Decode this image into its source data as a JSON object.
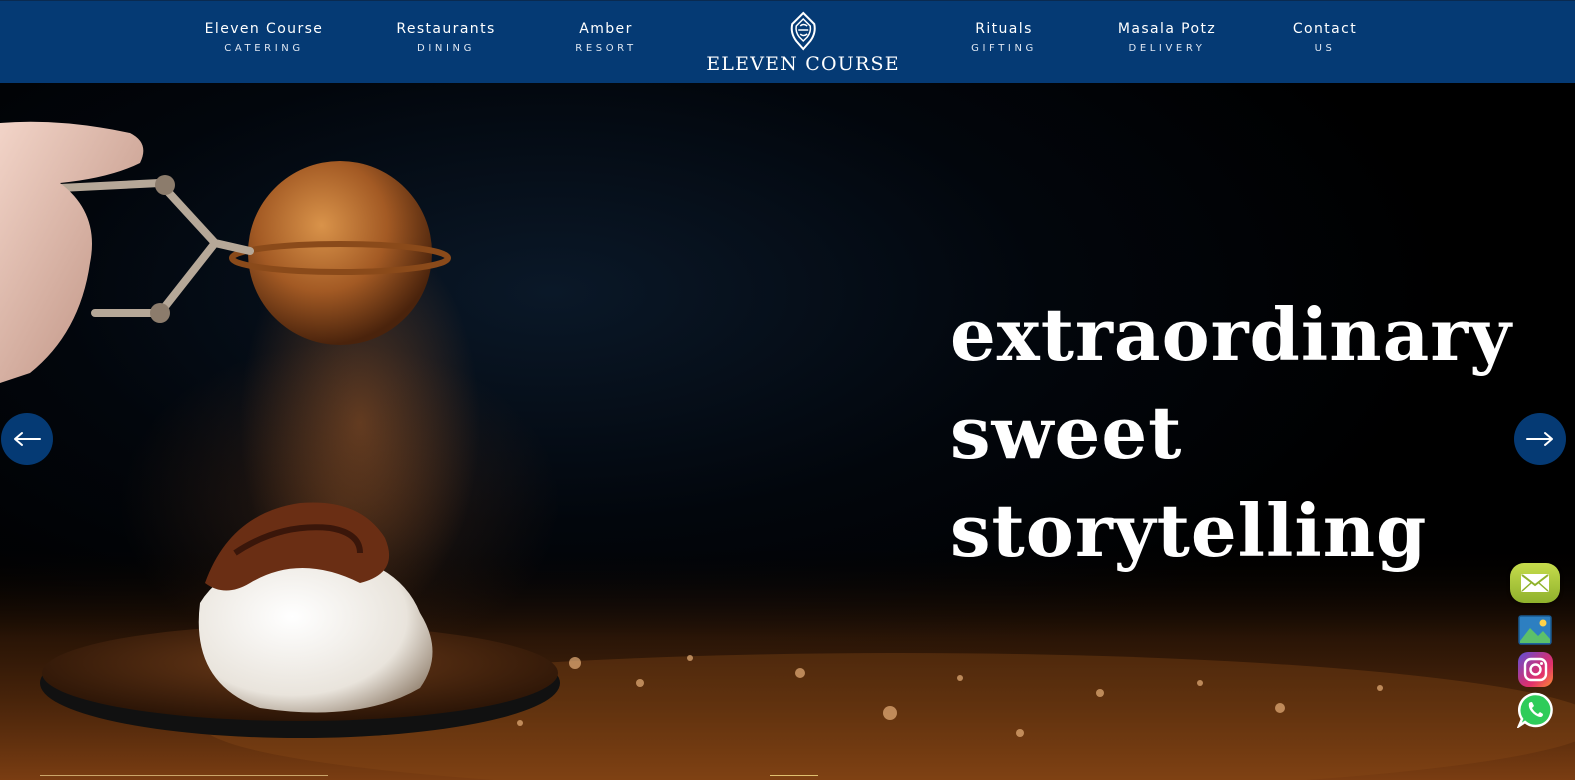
{
  "header": {
    "nav_left": [
      {
        "title": "Eleven Course",
        "subtitle": "CATERING"
      },
      {
        "title": "Restaurants",
        "subtitle": "DINING"
      },
      {
        "title": "Amber",
        "subtitle": "RESORT"
      }
    ],
    "logo_text": "ELEVEN COURSE",
    "nav_right": [
      {
        "title": "Rituals",
        "subtitle": "GIFTING"
      },
      {
        "title": "Masala Potz",
        "subtitle": "DELIVERY"
      },
      {
        "title": "Contact",
        "subtitle": "US"
      }
    ],
    "background_color": "#053a74"
  },
  "hero": {
    "heading_lines": [
      "extraordinary",
      "sweet",
      "storytelling"
    ],
    "prev_icon": "arrow-left-icon",
    "next_icon": "arrow-right-icon"
  },
  "social": [
    "email-icon",
    "gallery-icon",
    "instagram-icon",
    "whatsapp-icon"
  ]
}
